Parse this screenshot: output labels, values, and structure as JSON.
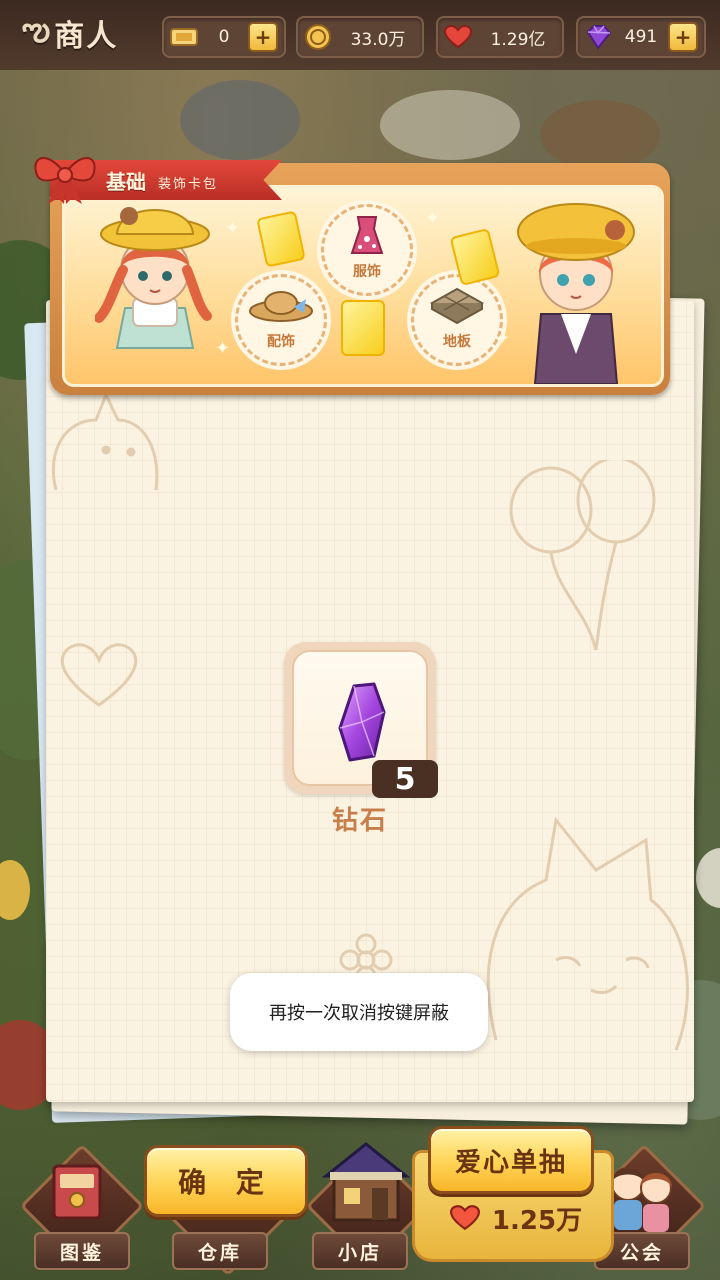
{
  "header": {
    "title": "商人",
    "resources": [
      {
        "icon": "ticket-icon",
        "value": "0",
        "has_plus": true
      },
      {
        "icon": "gold-coin-icon",
        "value": "33.0万",
        "has_plus": false
      },
      {
        "icon": "heart-icon",
        "value": "1.29亿",
        "has_plus": false
      },
      {
        "icon": "purple-gem-icon",
        "value": "491",
        "has_plus": true
      }
    ]
  },
  "banner": {
    "title": "基础",
    "subtitle": "装饰卡包",
    "categories": [
      "服饰",
      "配饰",
      "地板"
    ]
  },
  "reward": {
    "icon": "purple-crystal-icon",
    "count": "5",
    "name": "钻石"
  },
  "toast": {
    "text": "再按一次取消按键屏蔽"
  },
  "actions": {
    "confirm_label": "确 定",
    "single_draw_label": "爱心单抽",
    "single_draw_cost": "1.25万",
    "cost_icon": "heart-icon"
  },
  "nav": {
    "items": [
      "图鉴",
      "仓库",
      "小店",
      "公会"
    ]
  },
  "colors": {
    "accent_gold": "#ffd65a",
    "ribbon_red": "#d13b30",
    "panel": "#fbf3e2",
    "dark_brown": "#4a2f23"
  }
}
